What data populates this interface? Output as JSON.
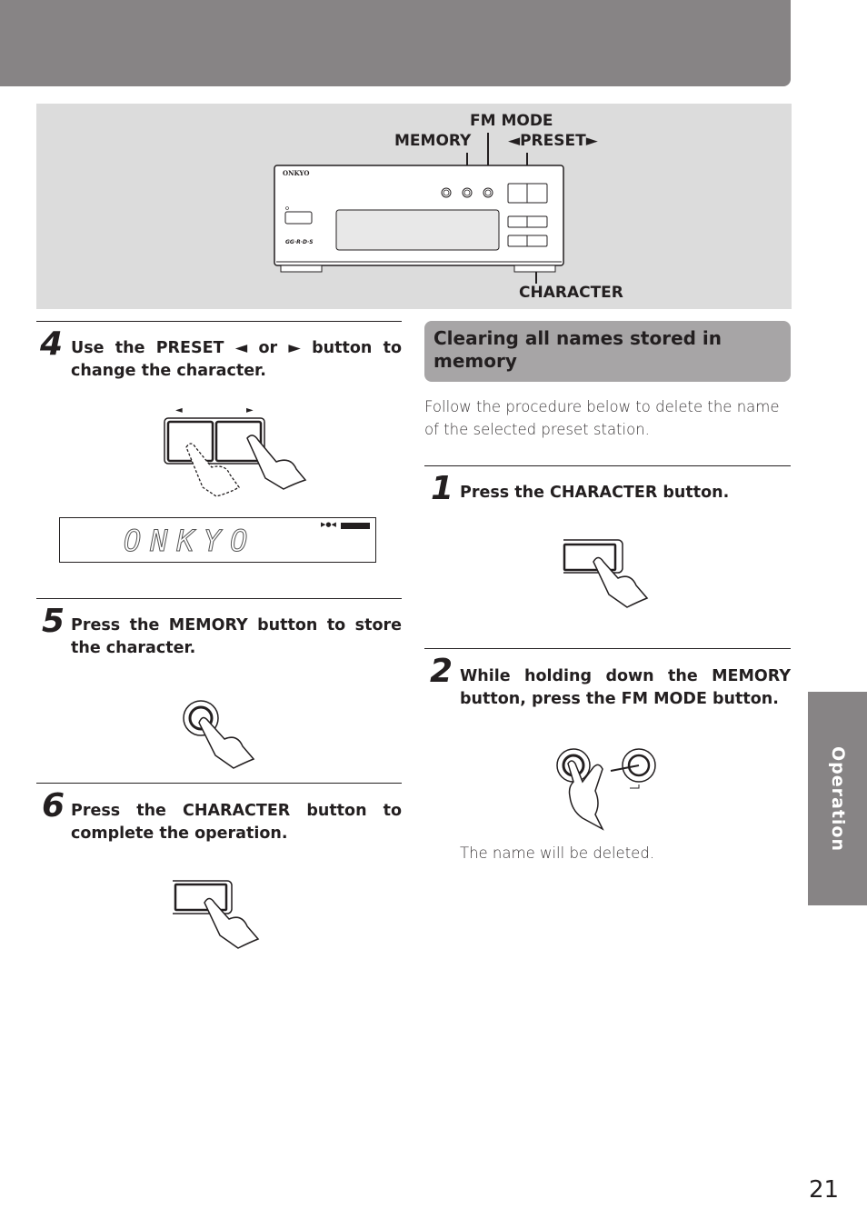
{
  "header": {
    "band_color": "#878485"
  },
  "diagram": {
    "labels": {
      "fm_mode": "FM MODE",
      "memory": "MEMORY",
      "preset": "◄PRESET►",
      "character": "CHARACTER"
    },
    "device": {
      "brand": "ONKYO",
      "rds_logo": "RDS"
    },
    "panel_color": "#dcdcdc"
  },
  "left_column": {
    "steps": [
      {
        "number": "4",
        "text": "Use the PRESET ◄ or ► button to change the character."
      },
      {
        "number": "5",
        "text": "Press the MEMORY button to store the character."
      },
      {
        "number": "6",
        "text": "Press the CHARACTER button to complete the operation."
      }
    ],
    "preset_arrows": {
      "left": "◄",
      "right": "►"
    },
    "display": {
      "text": "ONKYO",
      "indicator": "▶●◀"
    }
  },
  "right_column": {
    "section_title": "Clearing all names stored in memory",
    "intro": "Follow the procedure below to delete the name of the selected preset station.",
    "steps": [
      {
        "number": "1",
        "text": "Press the CHARACTER button."
      },
      {
        "number": "2",
        "text": "While holding down the MEMORY button, press the FM MODE button."
      }
    ],
    "result": "The name will be deleted."
  },
  "side_tab": {
    "label": "Operation",
    "color": "#878485"
  },
  "page_number": "21"
}
